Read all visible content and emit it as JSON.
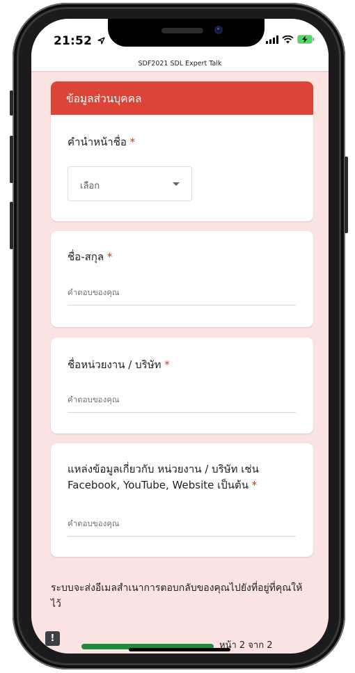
{
  "status_bar": {
    "time": "21:52"
  },
  "header": {
    "title": "SDF2021 SDL Expert Talk"
  },
  "section": {
    "title": "ข้อมูลส่วนบุคคล"
  },
  "questions": [
    {
      "label": "คำนำหน้าชื่อ",
      "required": "*",
      "type": "select",
      "value": "เลือก"
    },
    {
      "label": "ชื่อ-สกุล",
      "required": "*",
      "type": "text",
      "placeholder": "คำตอบของคุณ"
    },
    {
      "label": "ชื่อหน่วยงาน / บริษัท",
      "required": "*",
      "type": "text",
      "placeholder": "คำตอบของคุณ"
    },
    {
      "label_line1": "แหล่งข้อมูลเกี่ยวกับ หน่วยงาน / บริษัท เช่น",
      "label_line2": "Facebook, YouTube, Website เป็นต้น",
      "required": "*",
      "type": "text",
      "placeholder": "คำตอบของคุณ"
    }
  ],
  "footer": {
    "email_note": "ระบบจะส่งอีเมลสำเนาการตอบกลับของคุณไปยังที่อยู่ที่คุณให้ไว้",
    "page_indicator": "หน้า 2 จาก 2",
    "progress": 1.0
  },
  "colors": {
    "accent": "#db4437",
    "background": "#fbe3e1",
    "required": "#d93025",
    "progress": "#1e8e3e"
  }
}
